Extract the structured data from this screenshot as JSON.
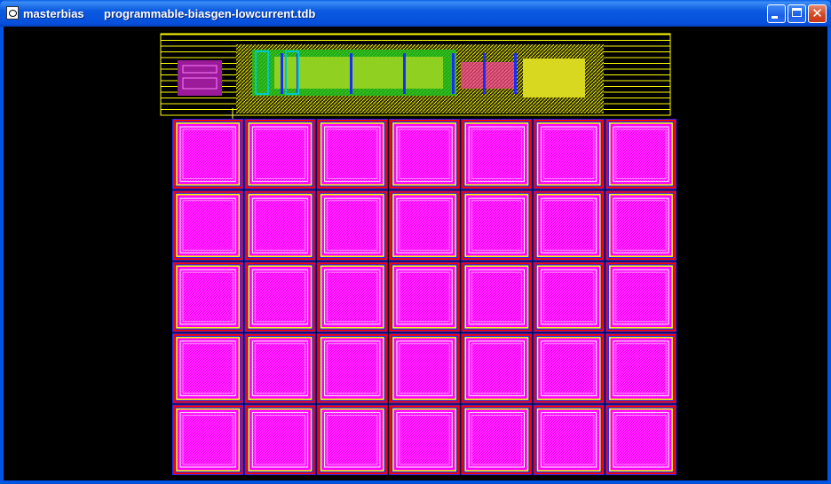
{
  "window": {
    "app_name": "masterbias",
    "file_name": "programmable-biasgen-lowcurrent.tdb",
    "controls": {
      "minimize_icon": "minimize-icon",
      "maximize_icon": "maximize-icon",
      "close_icon": "close-icon",
      "close_glyph": "✕"
    }
  },
  "layout_view": {
    "capacitor_array": {
      "rows": 5,
      "columns": 7
    },
    "colors": {
      "background": "#000000",
      "capacitor_fill": "#ff00ff",
      "metal_blue": "#1a2dff",
      "metal_red": "#ff0000",
      "metal_yellow": "#ffff00",
      "ring_white": "#ffffff",
      "poly_green": "#20c020",
      "well_cyan": "#00c8c8",
      "logo_purple": "#9a1a9a"
    }
  }
}
